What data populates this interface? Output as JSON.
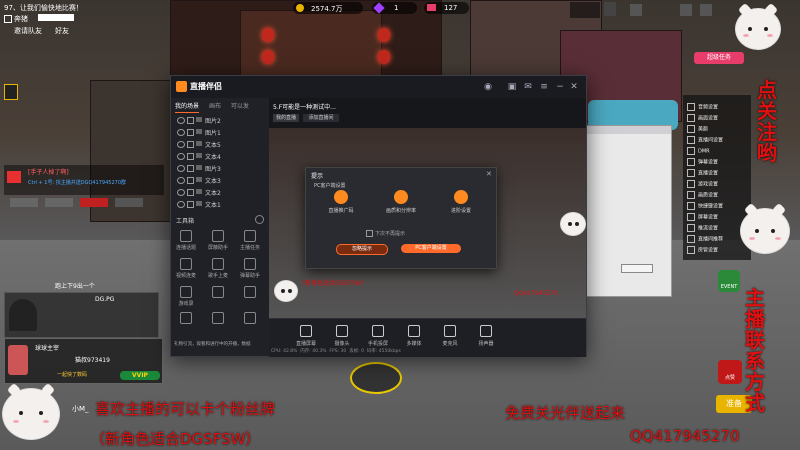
{
  "hud": {
    "top_left_title": "97、让我们愉快地比赛！",
    "tl_row1": "奔猪",
    "tl_row2a": "邀请队友",
    "tl_row2b": "好友",
    "coins": "2574.7万",
    "gems": "1",
    "tickets": "127",
    "marquee_red": "[手子人掉了啊]",
    "marquee_blue": "Ctrl + 1号: 找主播并送DGQ417945270群",
    "speaker_tag": "跑上下9出一个",
    "dg_tag": "DG.PG",
    "player_name": "球球主宰",
    "player_id": "猫叔973419",
    "vip": "VVIP",
    "player_hint": "一起快了数码",
    "minor": "小M_",
    "chevron": "<"
  },
  "overlay": {
    "ask_follow": "点关注哟",
    "contact_vertical": "主播联系方式",
    "ticker_left": "喜欢主播的可以卡个粉丝牌",
    "ticker_left_sub": "（新角色适合DGSFSW）",
    "ticker_right": "免费关光伴送起来",
    "ticker_right_sub": "QQ417945270",
    "preview_ticker": "（新角色适合DGSFSW）",
    "preview_qq": "QQ417945270",
    "mission": "超级任务",
    "event_btn": "EVENT",
    "ready_btn": "准备",
    "cheer_btn": "点赞"
  },
  "app": {
    "title": "直播伴侣",
    "tabs": [
      "我的场景",
      "画布",
      "可以发"
    ],
    "window_title": "5.F可能是一种测试中...",
    "scene_buttons": [
      "我的直播",
      "添加直播间"
    ],
    "sources": [
      "图片2",
      "图片1",
      "文本5",
      "文本4",
      "图片3",
      "文本3",
      "文本2",
      "文本1"
    ],
    "tools_header": "工具箱",
    "tools": [
      "连播话题",
      "屏蔽助手",
      "主播任务",
      "视频连麦",
      "歌手上麦",
      "弹幕助手",
      "游戏录",
      "",
      "",
      "",
      "",
      ""
    ],
    "tip": "礼物引流，观看和进行中的开播，数据",
    "bottom_actions": [
      "直播屏幕",
      "摄像头",
      "手机投屏",
      "多媒体",
      "麦克风",
      "扬声器"
    ],
    "status": [
      "CPU: 42.8%",
      "内存: 40.3%",
      "FPS: 30",
      "丢帧: 0",
      "码率: 4550kbps"
    ],
    "dialog": {
      "title": "提示",
      "subtitle": "PC客户端设置",
      "options": [
        "直播推广码",
        "画质和分辨率",
        "进阶设置"
      ],
      "checkbox": "下次不再提示",
      "secondary": "忽略提示",
      "primary": "PC客户端设置"
    }
  },
  "right_panel": {
    "items": [
      "音频设置",
      "画面设置",
      "美颜",
      "直播间设置",
      "DMR",
      "弹幕设置",
      "直播设置",
      "游戏设置",
      "画质设置",
      "快捷键设置",
      "屏幕设置",
      "推流设置",
      "直播间推荐",
      "房管设置"
    ]
  },
  "colors": {
    "accent": "#ff6a2b",
    "red_text": "#e01010",
    "vip_gold": "#e8b400"
  }
}
